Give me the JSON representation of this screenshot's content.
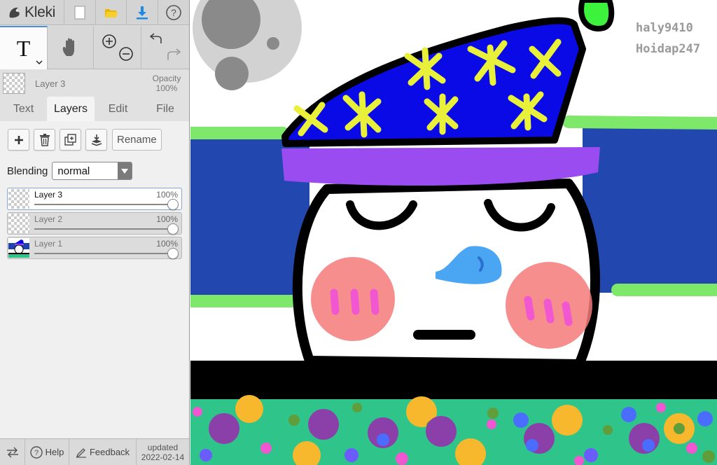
{
  "app": {
    "name": "Kleki"
  },
  "tools": {
    "text_glyph": "T"
  },
  "current_layer": {
    "name": "Layer 3",
    "opacity_label": "Opacity",
    "opacity_value": "100%"
  },
  "tabs": [
    {
      "label": "Text"
    },
    {
      "label": "Layers"
    },
    {
      "label": "Edit"
    },
    {
      "label": "File"
    }
  ],
  "layers_panel": {
    "rename_label": "Rename",
    "blending_label": "Blending",
    "blending_value": "normal",
    "layers": [
      {
        "name": "Layer 3",
        "opacity": "100%",
        "opacity_fraction": 1.0
      },
      {
        "name": "Layer 2",
        "opacity": "100%",
        "opacity_fraction": 1.0
      },
      {
        "name": "Layer 1",
        "opacity": "100%",
        "opacity_fraction": 1.0
      }
    ]
  },
  "footer": {
    "help_label": "Help",
    "feedback_label": "Feedback",
    "updated_label": "updated",
    "updated_date": "2022-02-14"
  },
  "canvas": {
    "watermark_line1": "haly9410",
    "watermark_line2": "Hoidap247"
  },
  "colors": {
    "accent": "#4a90d9",
    "download_icon": "#1e88e5",
    "folder_icon": "#f5c518",
    "hat_blue": "#0a0ae6",
    "hat_band": "#9b4cf0",
    "stars": "#e8f03a",
    "ground_green": "#2ec48a"
  }
}
